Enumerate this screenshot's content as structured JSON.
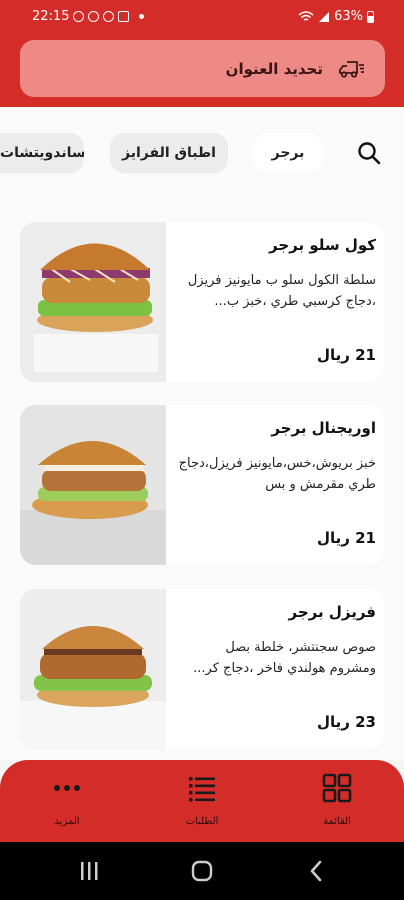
{
  "status_bar": {
    "time": "22:15",
    "battery": "63%"
  },
  "header": {
    "address_label": "تحديد العنوان"
  },
  "categories": [
    {
      "label": "برجر",
      "active": true
    },
    {
      "label": "اطباق الفرايز",
      "active": false
    },
    {
      "label": "الساندويتشات",
      "active": false
    }
  ],
  "products": [
    {
      "name": "كول سلو برجر",
      "description": "سلطة الكول سلو ب مايونيز فريزل ،دجاج كرسبي طري ،خبز ب...",
      "price": "21 ريال"
    },
    {
      "name": "اوريجنال برجر",
      "description": "خبز بريوش،خس،مايونيز فريزل،دجاج طري مقرمش و بس",
      "price": "21 ريال"
    },
    {
      "name": "فريزل برجر",
      "description": "صوص سجنتشر، خلطة بصل ومشروم هولندي فاخر ،دجاج كر...",
      "price": "23 ريال"
    }
  ],
  "bottom_nav": [
    {
      "label": "القائمة",
      "icon": "grid-icon"
    },
    {
      "label": "الطلبات",
      "icon": "list-icon"
    },
    {
      "label": "المزيد",
      "icon": "more-dots-icon"
    }
  ],
  "colors": {
    "brand_red": "#d42d29",
    "address_button": "#ee8a86",
    "card_bg": "#ffffff",
    "page_bg": "#fafafa"
  }
}
